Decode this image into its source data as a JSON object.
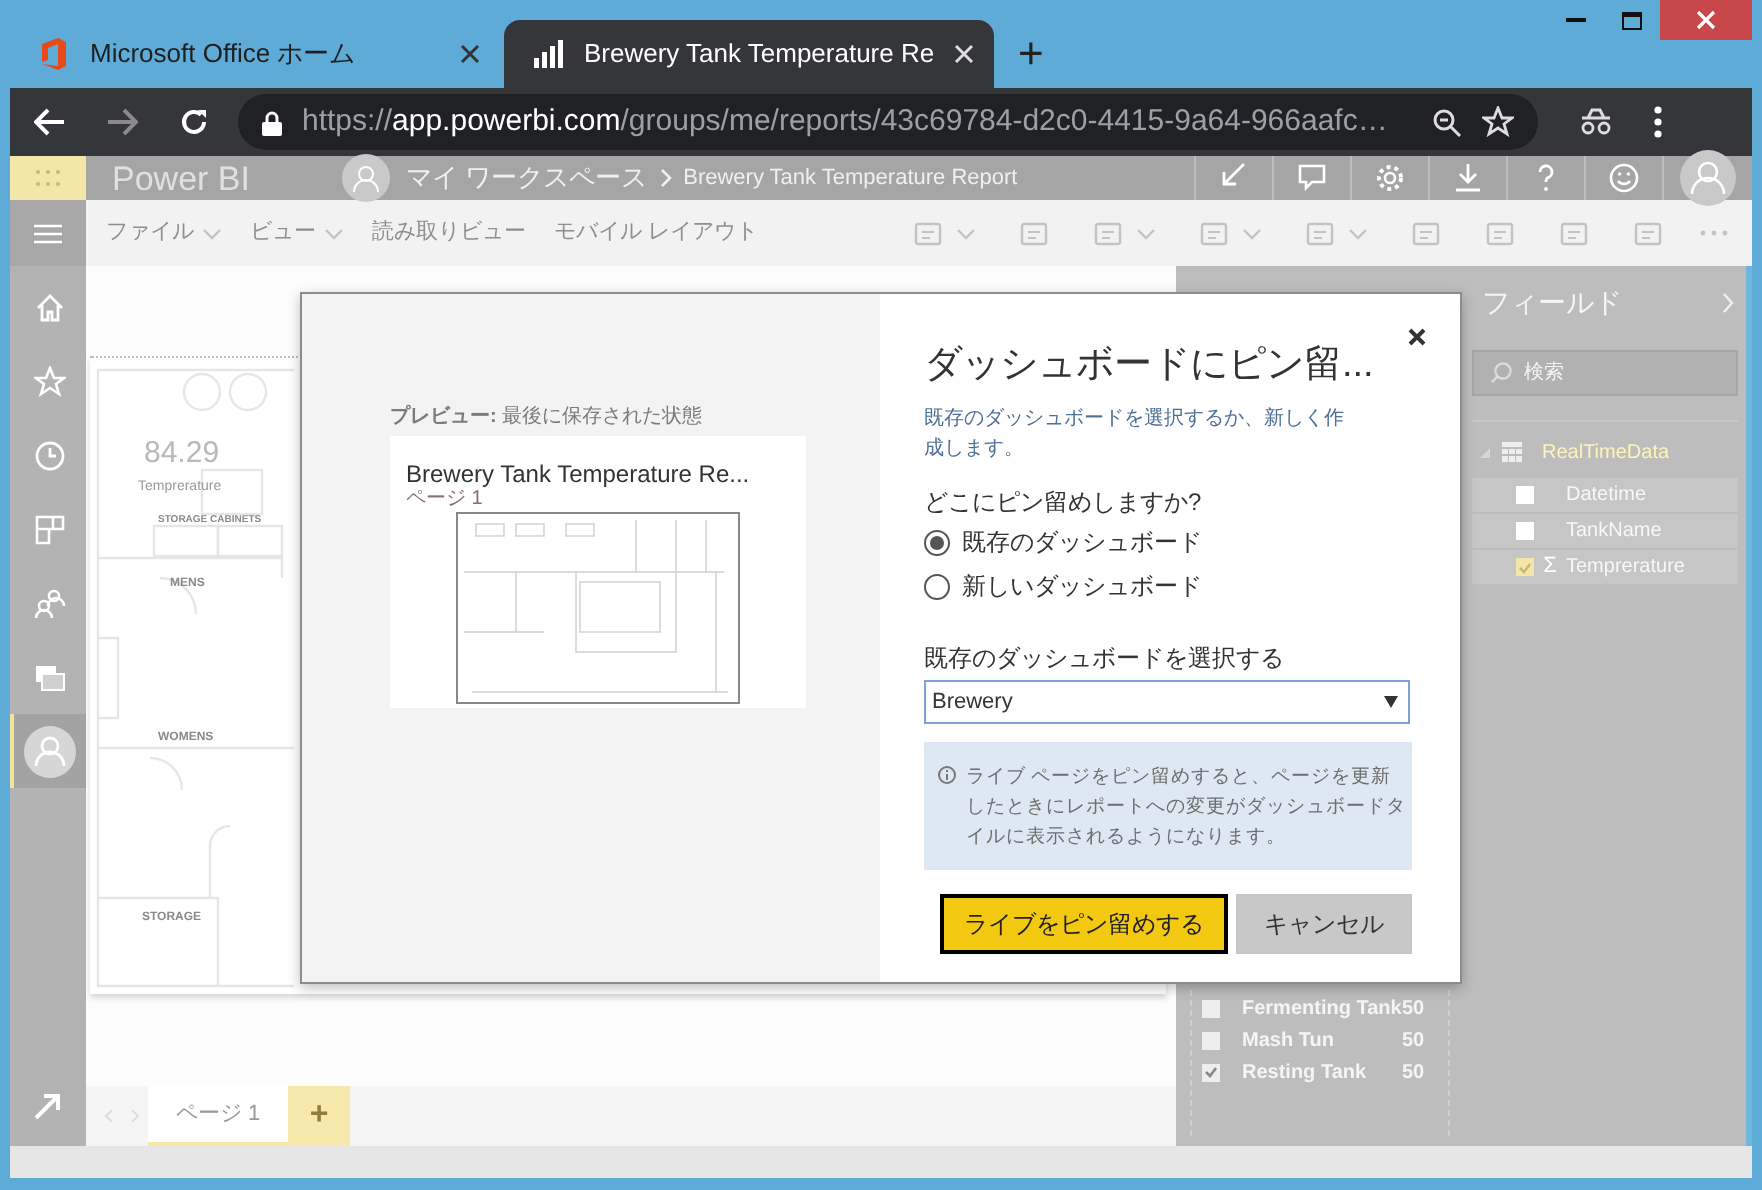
{
  "browser": {
    "tabs": [
      {
        "title": "Microsoft Office ホーム",
        "selected": false
      },
      {
        "title": "Brewery Tank Temperature Re",
        "selected": true
      }
    ],
    "new_tab": "+",
    "url": {
      "scheme": "https://",
      "host": "app.powerbi.com",
      "path": "/groups/me/reports/43c69784-d2c0-4415-9a64-966aafc…"
    }
  },
  "app": {
    "brand": "Power BI",
    "breadcrumb": [
      "マイ ワークスペース",
      "Brewery Tank Temperature Report"
    ],
    "nav": [
      {
        "kind": "home",
        "selected": false
      },
      {
        "kind": "favorites",
        "selected": false
      },
      {
        "kind": "recent",
        "selected": false
      },
      {
        "kind": "apps",
        "selected": false
      },
      {
        "kind": "shared",
        "selected": false
      },
      {
        "kind": "workspaces",
        "selected": false
      },
      {
        "kind": "my-workspace",
        "selected": true
      }
    ],
    "menu": [
      {
        "label": "ファイル",
        "dropdown": true
      },
      {
        "label": "ビュー",
        "dropdown": true
      },
      {
        "label": "読み取りビュー",
        "dropdown": false
      },
      {
        "label": "モバイル レイアウト",
        "dropdown": false
      }
    ],
    "canvas": {
      "card_value": "84.29",
      "card_label": "Temprerature",
      "room_labels": [
        {
          "kind": "cabinets",
          "text": "STORAGE CABINETS"
        },
        {
          "kind": "mens",
          "text": "MENS"
        },
        {
          "kind": "womens",
          "text": "WOMENS"
        },
        {
          "kind": "storage",
          "text": "STORAGE"
        }
      ]
    },
    "page_tabs": [
      {
        "label": "ページ 1",
        "selected": true
      }
    ],
    "add_page": "+",
    "filter_items": [
      {
        "label": "Fermenting Tank",
        "count": "50",
        "checked": false
      },
      {
        "label": "Mash Tun",
        "count": "50",
        "checked": false
      },
      {
        "label": "Resting Tank",
        "count": "50",
        "checked": true
      }
    ],
    "fields_panel": {
      "title": "フィールド",
      "search_placeholder": "検索",
      "table": "RealTimeData",
      "fields": [
        {
          "name": "Datetime",
          "checked": false
        },
        {
          "name": "TankName",
          "checked": false
        },
        {
          "name": "Temprerature",
          "checked": true,
          "symbol": "Σ"
        }
      ]
    }
  },
  "dialog": {
    "preview_label": "**プレビュー:** 最後に保存された状態",
    "preview_title": "Brewery Tank Temperature Re...",
    "preview_page": "ページ 1",
    "title": "ダッシュボードにピン留...",
    "subtitle": "既存のダッシュボードを選択するか、新しく作成します。",
    "question": "どこにピン留めしますか?",
    "options": [
      {
        "label": "既存のダッシュボード",
        "selected": true
      },
      {
        "label": "新しいダッシュボード",
        "selected": false
      }
    ],
    "select_label": "既存のダッシュボードを選択する",
    "select_value": "Brewery",
    "info": "ライブ ページをピン留めすると、ページを更新したときにレポートへの変更がダッシュボードタイルに表示されるようになります。",
    "primary_button": "ライブをピン留めする",
    "cancel_button": "キャンセル"
  }
}
